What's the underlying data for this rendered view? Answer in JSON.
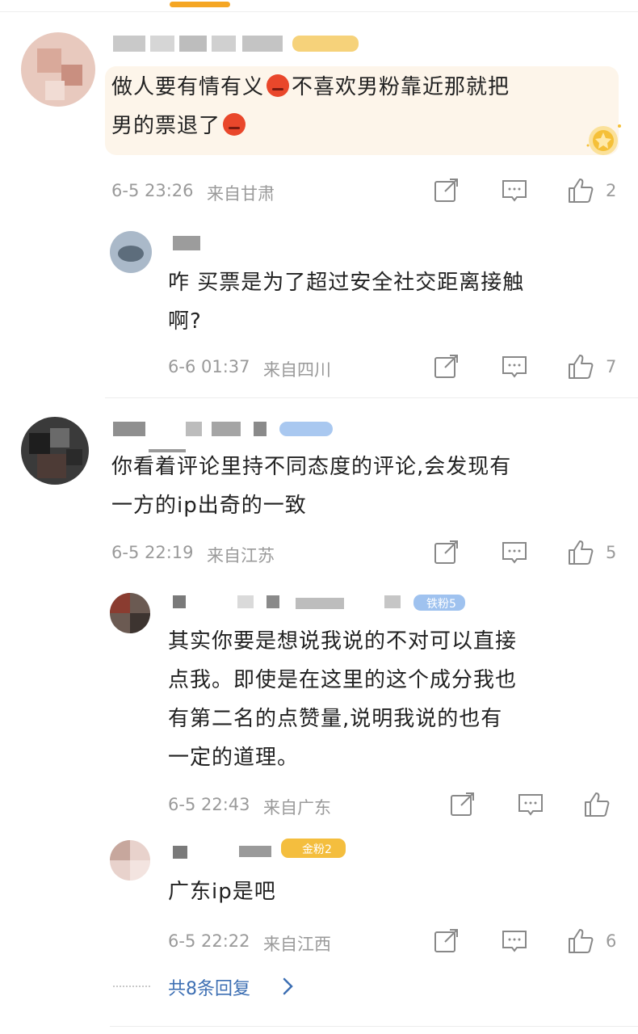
{
  "comments": [
    {
      "text_line1": "做人要有情有义",
      "text_line2": "不喜欢男粉靠近那就把",
      "text_line3": "男的票退了",
      "time": "6-5 23:26",
      "location": "来自甘肃",
      "likes": "2"
    },
    {
      "text_line1": "咋 买票是为了超过安全社交距离接触",
      "text_line2": "啊?",
      "time": "6-6 01:37",
      "location": "来自四川",
      "likes": "7"
    },
    {
      "text_line1": "你看着评论里持不同态度的评论,会发现有",
      "text_line2": "一方的ip出奇的一致",
      "time": "6-5 22:19",
      "location": "来自江苏",
      "likes": "5"
    },
    {
      "badge": "铁粉5",
      "text_line1": "其实你要是想说我说的不对可以直接",
      "text_line2": "点我。即使是在这里的这个成分我也",
      "text_line3": "有第二名的点赞量,说明我说的也有",
      "text_line4": "一定的道理。",
      "time": "6-5 22:43",
      "location": "来自广东"
    },
    {
      "badge": "金粉2",
      "text_line1": "广东ip是吧",
      "time": "6-5 22:22",
      "location": "来自江西",
      "likes": "6"
    }
  ],
  "more_replies": "共8条回复",
  "icons": [
    "share-icon",
    "comment-icon",
    "like-icon",
    "chevron-right-icon",
    "gold-badge-icon"
  ],
  "colors": {
    "accent": "#f5a623",
    "link": "#3d6fb3",
    "meta": "#9a9a9a",
    "highlight_bg": "#fdf5ea"
  }
}
